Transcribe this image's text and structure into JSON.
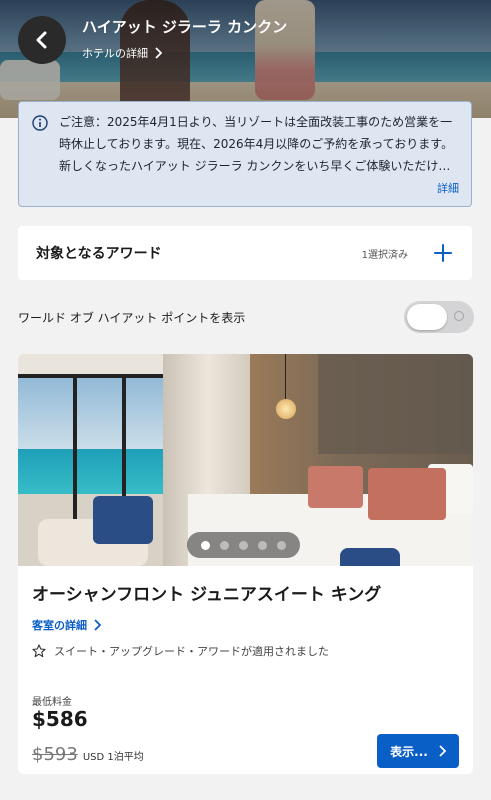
{
  "header": {
    "hotel_name": "ハイアット ジラーラ カンクン",
    "details_link": "ホテルの詳細",
    "back_icon": "chevron-left-icon"
  },
  "notice": {
    "text": "ご注意：2025年4月1日より、当リゾートは全面改装工事のため営業を一時休止しております。現在、2026年4月以降のご予約を承っております。新しくなったハイアット ジラーラ カンクンをいち早くご体験いただけます。",
    "more_label": "詳細",
    "icon": "info-icon"
  },
  "award": {
    "title": "対象となるアワード",
    "selected_count": "1選択済み",
    "icon": "plus-icon"
  },
  "points_toggle": {
    "label": "ワールド オブ ハイアット ポイントを表示",
    "enabled": false
  },
  "room": {
    "name": "オーシャンフロント ジュニアスイート キング",
    "details_link": "客室の詳細",
    "upgrade_note": "スイート・アップグレード・アワードが適用されました",
    "min_rate_label": "最低料金",
    "price": "$586",
    "original_price": "$593",
    "price_unit": "USD 1泊平均",
    "view_button": "表示...",
    "carousel": {
      "total": 5,
      "active_index": 0
    }
  },
  "colors": {
    "accent": "#0a5fc6",
    "notice_bg": "#dde6f1",
    "page_bg": "#f2f2f3"
  }
}
